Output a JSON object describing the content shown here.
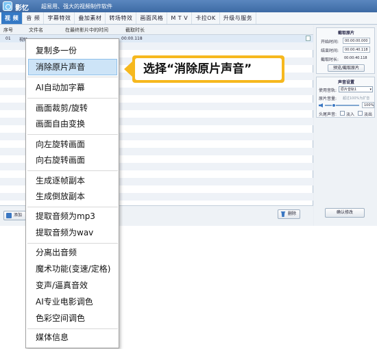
{
  "app": {
    "name": "影忆",
    "slogan": "超易用、强大的视频制作软件"
  },
  "tabs": [
    {
      "label": "视 频",
      "active": true
    },
    {
      "label": "音 频"
    },
    {
      "label": "字幕特效"
    },
    {
      "label": "叠加素材"
    },
    {
      "label": "转场特效"
    },
    {
      "label": "画面风格"
    },
    {
      "label": "M T V"
    },
    {
      "label": "卡拉OK"
    },
    {
      "label": "升级与服务"
    }
  ],
  "table": {
    "headers": [
      "序号",
      "文件名",
      "在最终影片中的时间",
      "截取时长"
    ],
    "first_row": {
      "index": "01",
      "name": "视频",
      "duration": "00:00.118"
    }
  },
  "right_panel": {
    "trim": {
      "title": "截取原片",
      "start_label": "开始时间:",
      "start_value": "00:00:00.000",
      "end_label": "结束时间:",
      "end_value": "00:00:40.118",
      "length_label": "截取时长:",
      "length_value": "00:00:40.118",
      "preview_button": "预览/截取原片"
    },
    "audio": {
      "title": "声音设置",
      "track_label": "使用音轨:",
      "track_value": "原片音轨1",
      "volume_label": "原片音量:",
      "volume_hint": "超过100%为扩音",
      "volume_value": "100%",
      "fade_label": "头尾声音:",
      "fade_in_label": "淡入",
      "fade_out_label": "淡出"
    },
    "confirm_button": "确认修改"
  },
  "bottom": {
    "add_button": "添加",
    "delete_button": "删除"
  },
  "context_menu": {
    "items": [
      "复制多一份",
      "消除原片声音",
      "AI自动加字幕",
      "画面裁剪/旋转",
      "画面自由变换",
      "向左旋转画面",
      "向右旋转画面",
      "生成逐帧副本",
      "生成倒放副本",
      "提取音频为mp3",
      "提取音频为wav",
      "分离出音频",
      "魔术功能(变速/定格)",
      "变声/逼真音效",
      "AI专业电影调色",
      "色彩空间调色",
      "媒体信息"
    ]
  },
  "callout": {
    "text": "选择“消除原片声音”"
  },
  "colors": {
    "accent": "#3479c5",
    "callout": "#f6b81e",
    "menu_highlight": "#cde4f7"
  }
}
